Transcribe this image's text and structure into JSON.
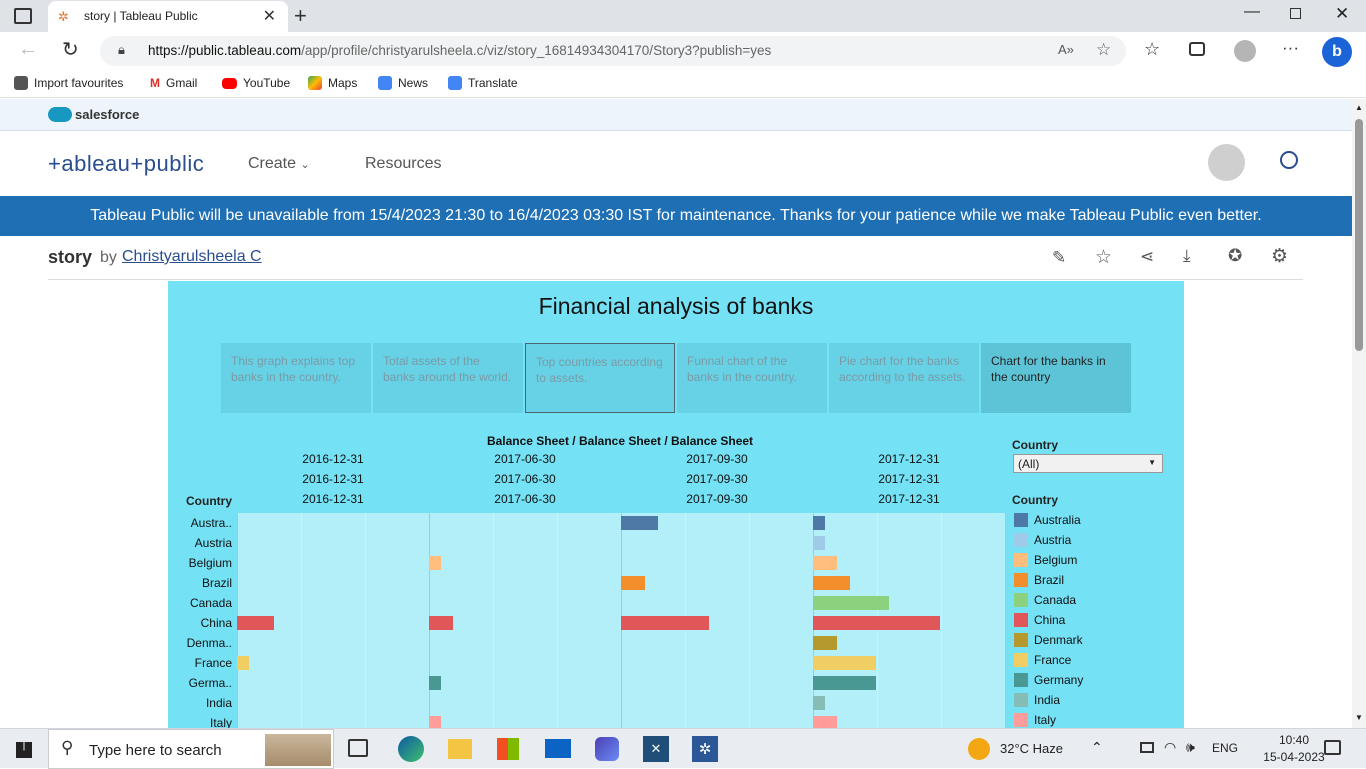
{
  "browser": {
    "tab_title": "story | Tableau Public",
    "url_host": "https://public.tableau.com",
    "url_path": "/app/profile/christyarulsheela.c/viz/story_16814934304170/Story3?publish=yes"
  },
  "favourites": [
    {
      "label": "Import favourites",
      "color": "#555555"
    },
    {
      "label": "Gmail",
      "color": "#d93025"
    },
    {
      "label": "YouTube",
      "color": "#ff0000"
    },
    {
      "label": "Maps",
      "color": "#34a853"
    },
    {
      "label": "News",
      "color": "#4285f4"
    },
    {
      "label": "Translate",
      "color": "#4285f4"
    }
  ],
  "salesforce": {
    "label": "salesforce"
  },
  "tableau": {
    "logo": "+ableau+public",
    "nav": [
      "Create",
      "Resources"
    ]
  },
  "banner": {
    "text": "Tableau Public will be unavailable from 15/4/2023 21:30 to 16/4/2023 03:30 IST for maintenance. Thanks for your patience while we make Tableau Public even better."
  },
  "viz_header": {
    "title": "story",
    "by": "by",
    "author": "Christyarulsheela C"
  },
  "viz": {
    "title": "Financial analysis of banks",
    "story_points": [
      "This graph explains top banks in the country.",
      "Total assets of the banks around the world.",
      "Top countries according to assets.",
      "Funnal chart of the banks in the country.",
      "Pie chart for the banks according to the assets.",
      "Chart for the banks in the country"
    ],
    "header_title": "Balance Sheet / Balance Sheet / Balance Sheet",
    "dates": [
      "2016-12-31",
      "2017-06-30",
      "2017-09-30",
      "2017-12-31"
    ],
    "country_col_label": "Country",
    "filter_label": "Country",
    "filter_value": "(All)",
    "legend_title": "Country"
  },
  "chart_data": {
    "type": "bar",
    "panels": [
      "2016-12-31",
      "2017-06-30",
      "2017-09-30",
      "2017-12-31"
    ],
    "categories": [
      "Austra..",
      "Austria",
      "Belgium",
      "Brazil",
      "Canada",
      "China",
      "Denma..",
      "France",
      "Germa..",
      "India",
      "Italy"
    ],
    "series": [
      {
        "name": "Australia",
        "color": "#4e79a7",
        "values": [
          0,
          0,
          0.29,
          0.09
        ]
      },
      {
        "name": "Austria",
        "color": "#a0cbe8",
        "values": [
          0,
          0,
          0,
          0.09
        ]
      },
      {
        "name": "Belgium",
        "color": "#ffbe7d",
        "values": [
          0,
          0.09,
          0,
          0.19
        ]
      },
      {
        "name": "Brazil",
        "color": "#f28e2b",
        "values": [
          0,
          0,
          0.19,
          0.29
        ]
      },
      {
        "name": "Canada",
        "color": "#8cd17d",
        "values": [
          0,
          0,
          0,
          0.59
        ]
      },
      {
        "name": "China",
        "color": "#e15759",
        "values": [
          0.29,
          0.19,
          0.69,
          0.99
        ]
      },
      {
        "name": "Denmark",
        "color": "#b6992d",
        "values": [
          0,
          0,
          0,
          0.19
        ]
      },
      {
        "name": "France",
        "color": "#f1ce63",
        "values": [
          0.09,
          0,
          0,
          0.49
        ]
      },
      {
        "name": "Germany",
        "color": "#499894",
        "values": [
          0,
          0.09,
          0,
          0.49
        ]
      },
      {
        "name": "India",
        "color": "#86bcb6",
        "values": [
          0,
          0,
          0,
          0.09
        ]
      },
      {
        "name": "Italy",
        "color": "#ff9d9a",
        "values": [
          0,
          0.09,
          0,
          0.19
        ]
      }
    ],
    "xmax": 1,
    "grid": true,
    "legend_position": "right"
  },
  "taskbar": {
    "search_placeholder": "Type here to search",
    "weather": "32°C  Haze",
    "lang": "ENG",
    "time": "10:40",
    "date": "15-04-2023"
  }
}
